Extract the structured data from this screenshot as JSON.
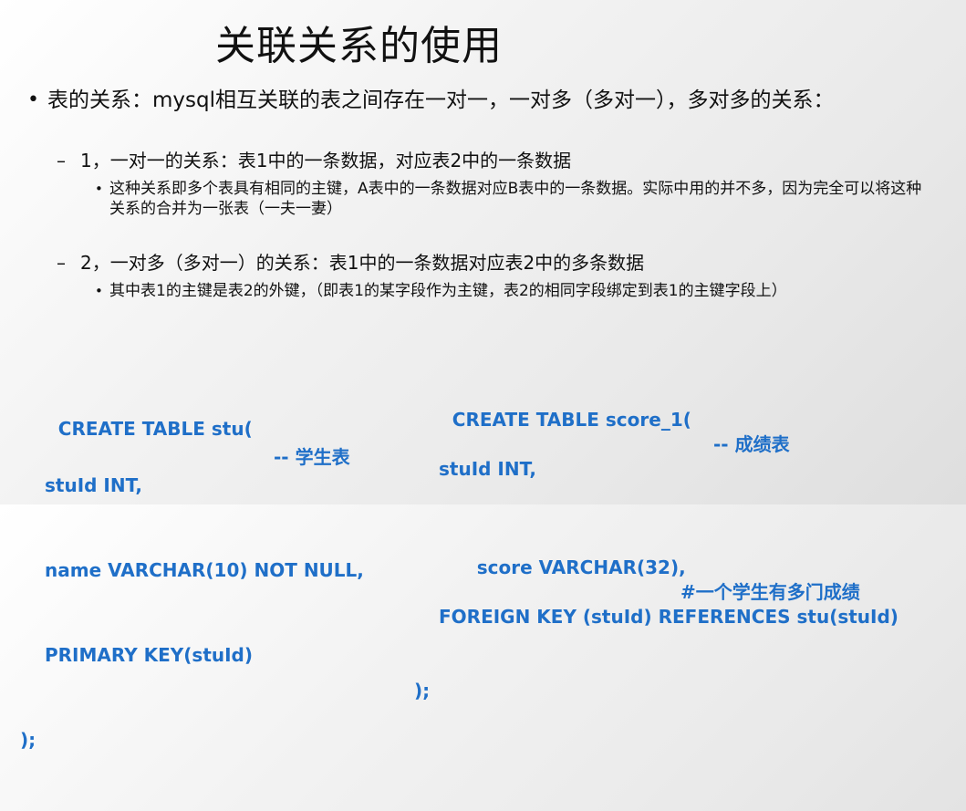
{
  "title": "关联关系的使用",
  "bullet_main": {
    "symbol": "•",
    "text": "表的关系：mysql相互关联的表之间存在一对一，一对多（多对一），多对多的关系："
  },
  "sub_items": [
    {
      "symbol": "–",
      "text": "1，一对一的关系：表1中的一条数据，对应表2中的一条数据",
      "detail_symbol": "•",
      "detail": "这种关系即多个表具有相同的主键，A表中的一条数据对应B表中的一条数据。实际中用的并不多，因为完全可以将这种关系的合并为一张表（一夫一妻）"
    },
    {
      "symbol": "–",
      "text": "2，一对多（多对一）的关系：表1中的一条数据对应表2中的多条数据",
      "detail_symbol": "•",
      "detail": "其中表1的主键是表2的外键，（即表1的某字段作为主键，表2的相同字段绑定到表1的主键字段上）"
    }
  ],
  "code_left": {
    "lines": [
      "CREATE TABLE stu(",
      "stuId INT,",
      "name VARCHAR(10) NOT NULL,",
      "PRIMARY KEY(stuId)",
      ");"
    ],
    "comment": "-- 学生表"
  },
  "code_right": {
    "lines": [
      "CREATE TABLE score_1(",
      "stuId INT,",
      "score VARCHAR(32),",
      "FOREIGN KEY (stuId) REFERENCES stu(stuId)",
      ");"
    ],
    "comment_1": "-- 成绩表",
    "comment_2": "#一个学生有多门成绩"
  },
  "colors": {
    "code": "#1f6fc8",
    "text": "#111111"
  }
}
